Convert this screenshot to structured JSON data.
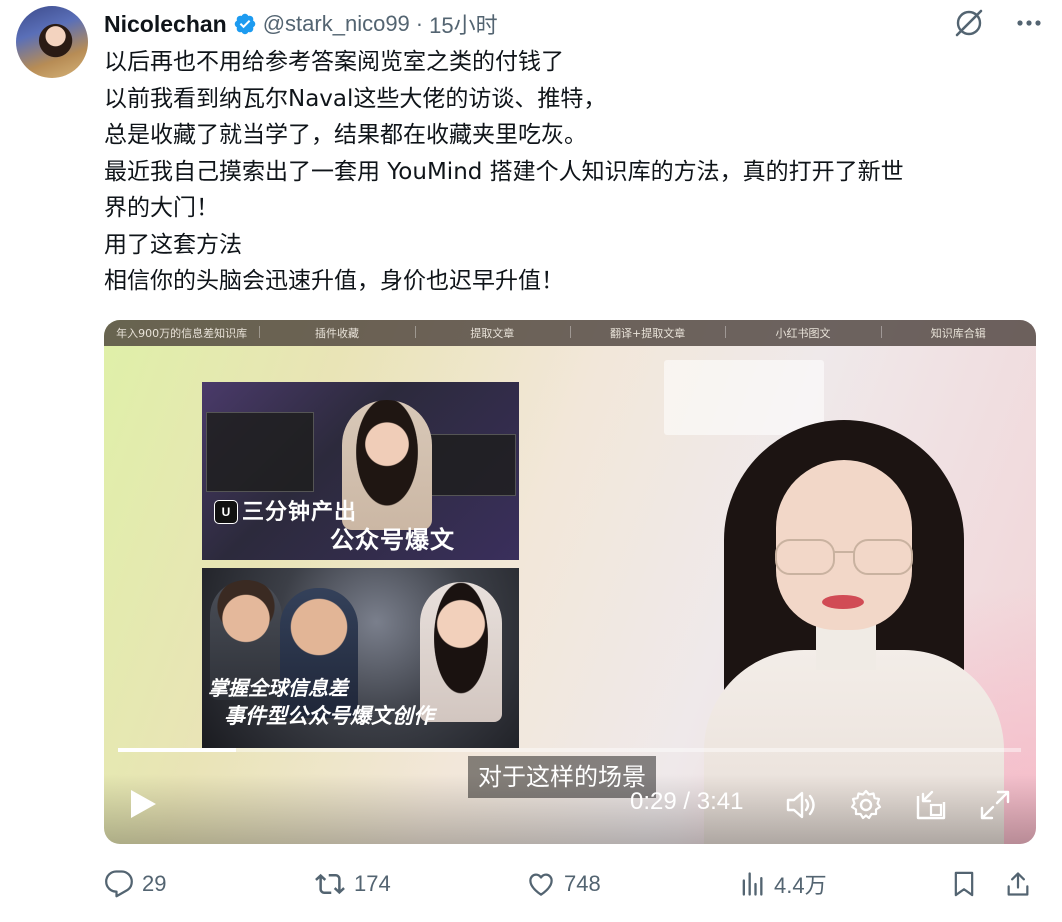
{
  "author": {
    "display_name": "Nicolechan",
    "handle": "@stark_nico99",
    "separator": "·",
    "time": "15小时"
  },
  "header_icons": [
    "grok-slash-icon",
    "more-icon"
  ],
  "tweet": {
    "lines": [
      "以后再也不用给参考答案阅览室之类的付钱了",
      "以前我看到纳瓦尔Naval这些大佬的访谈、推特，",
      "总是收藏了就当学了，结果都在收藏夹里吃灰。",
      "最近我自己摸索出了一套用 YouMind 搭建个人知识库的方法，真的打开了新世",
      "界的大门！",
      "用了这套方法",
      "相信你的头脑会迅速升值，身价也迟早升值！"
    ]
  },
  "video": {
    "top_tabs": [
      "年入900万的信息差知识库",
      "插件收藏",
      "提取文章",
      "翻译+提取文章",
      "小红书图文",
      "知识库合辑"
    ],
    "thumb1": {
      "logo": "U",
      "caption_line1": "三分钟产出",
      "caption_line2": "公众号爆文"
    },
    "thumb2": {
      "caption_line1": "掌握全球信息差",
      "caption_line2": "事件型公众号爆文创作"
    },
    "subtitle": "对于这样的场景",
    "timecode": "0:29 / 3:41",
    "progress": 0.131,
    "control_icons": [
      "play-icon",
      "volume-icon",
      "settings-icon",
      "pip-icon",
      "fullscreen-icon"
    ]
  },
  "actions": {
    "replies": "29",
    "reposts": "174",
    "likes": "748",
    "views": "4.4万"
  },
  "colors": {
    "text_primary": "#0f1419",
    "text_secondary": "#536471",
    "verified_blue": "#1d9bf0"
  }
}
